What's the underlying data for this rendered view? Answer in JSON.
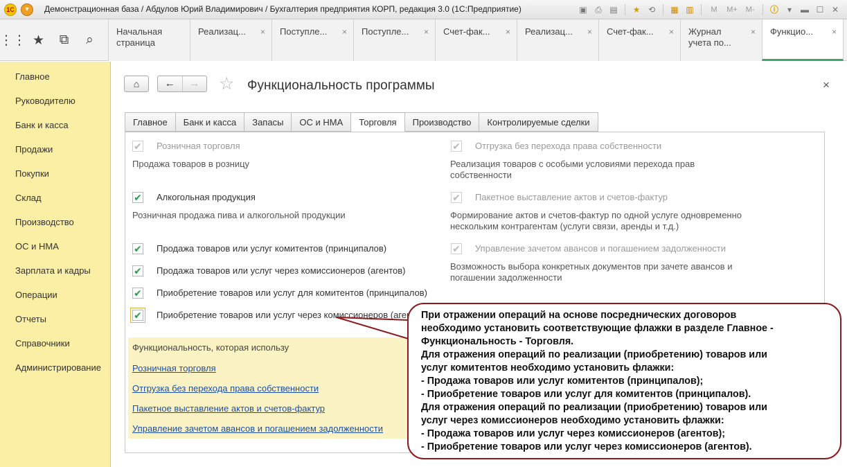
{
  "window": {
    "logo": "1С",
    "title": "Демонстрационная база / Абдулов Юрий Владимирович / Бухгалтерия предприятия КОРП, редакция 3.0  (1С:Предприятие)",
    "toolbar_icons": [
      "save-icon",
      "print-icon",
      "preview-icon",
      "favorites-add-icon",
      "history-icon",
      "calculator-icon",
      "calendar-icon"
    ],
    "memory": [
      "M",
      "M+",
      "M-"
    ],
    "info_icon": "info-icon",
    "minimize": "▬",
    "maximize": "☐",
    "close": "✕"
  },
  "quick_icons": [
    "apps-grid-icon",
    "favorites-star-icon",
    "history-icon",
    "search-icon"
  ],
  "tabs": [
    {
      "label": "Начальная страница",
      "closable": false,
      "active": false
    },
    {
      "label": "Реализац...",
      "closable": true,
      "active": false
    },
    {
      "label": "Поступле...",
      "closable": true,
      "active": false
    },
    {
      "label": "Поступле...",
      "closable": true,
      "active": false
    },
    {
      "label": "Счет-фак...",
      "closable": true,
      "active": false
    },
    {
      "label": "Реализац...",
      "closable": true,
      "active": false
    },
    {
      "label": "Счет-фак...",
      "closable": true,
      "active": false
    },
    {
      "label": "Журнал учета по...",
      "closable": true,
      "active": false
    },
    {
      "label": "Функцио...",
      "closable": true,
      "active": true
    }
  ],
  "sidebar": {
    "items": [
      "Главное",
      "Руководителю",
      "Банк и касса",
      "Продажи",
      "Покупки",
      "Склад",
      "Производство",
      "ОС и НМА",
      "Зарплата и кадры",
      "Операции",
      "Отчеты",
      "Справочники",
      "Администрирование"
    ]
  },
  "page": {
    "title": "Функциональность программы",
    "close": "×",
    "home": "⌂",
    "back": "←",
    "forward": "→",
    "favorite": "☆"
  },
  "form_tabs": [
    {
      "label": "Главное",
      "active": false
    },
    {
      "label": "Банк и касса",
      "active": false
    },
    {
      "label": "Запасы",
      "active": false
    },
    {
      "label": "ОС и НМА",
      "active": false
    },
    {
      "label": "Торговля",
      "active": true
    },
    {
      "label": "Производство",
      "active": false
    },
    {
      "label": "Контролируемые сделки",
      "active": false
    }
  ],
  "left_options": [
    {
      "label": "Розничная торговля",
      "checked": true,
      "disabled": true,
      "desc": "Продажа товаров в розницу"
    },
    {
      "label": "Алкогольная продукция",
      "checked": true,
      "disabled": false,
      "desc": "Розничная продажа пива и алкогольной продукции"
    },
    {
      "label": "Продажа товаров или услуг комитентов (принципалов)",
      "checked": true,
      "disabled": false
    },
    {
      "label": "Продажа товаров или услуг через комиссионеров (агентов)",
      "checked": true,
      "disabled": false
    },
    {
      "label": "Приобретение товаров или услуг для комитентов (принципалов)",
      "checked": true,
      "disabled": false
    },
    {
      "label": "Приобретение товаров или услуг через комиссионеров (агентов)",
      "checked": true,
      "disabled": false,
      "focused": true
    }
  ],
  "right_options": [
    {
      "label": "Отгрузка без перехода права собственности",
      "checked": true,
      "disabled": true,
      "desc_line1": "Реализация товаров с особыми условиями перехода прав",
      "desc_line2": "собственности"
    },
    {
      "label": "Пакетное выставление актов и счетов-фактур",
      "checked": true,
      "disabled": true,
      "desc_line1": "Формирование актов и счетов-фактур по одной услуге одновременно",
      "desc_line2": "нескольким контрагентам (услуги связи, аренды и т.д.)"
    },
    {
      "label": "Управление зачетом авансов и погашением задолженности",
      "checked": true,
      "disabled": true,
      "desc_line1": "Возможность выбора конкретных документов при зачете авансов и",
      "desc_line2": "погашении задолженности"
    }
  ],
  "info": {
    "title": "Функциональность, которая использу",
    "links": [
      "Розничная торговля",
      "Отгрузка без перехода права собственности",
      "Пакетное выставление актов и счетов-фактур",
      "Управление зачетом авансов и погашением задолженности"
    ]
  },
  "callout": {
    "border_color": "#8b1b1f",
    "lines": [
      "При отражении операций на основе посреднических договоров",
      "необходимо установить соответствующие флажки в разделе Главное -",
      "Функциональность - Торговля.",
      "Для отражения операций по реализации (приобретению) товаров или",
      "услуг комитентов необходимо установить флажки:",
      "- Продажа товаров или услуг комитентов (принципалов);",
      "- Приобретение товаров или услуг для комитентов (принципалов).",
      "Для отражения операций по реализации (приобретению) товаров или",
      "услуг через комиссионеров необходимо установить флажки:",
      "- Продажа товаров или услуг через комиссионеров (агентов);",
      "- Приобретение товаров или услуг через комиссионеров (агентов)."
    ]
  },
  "colors": {
    "sidebar_bg": "#fbeea5",
    "check_green": "#2b9a49",
    "active_tab_underline": "#3aa86b",
    "link": "#1c4fa6"
  }
}
